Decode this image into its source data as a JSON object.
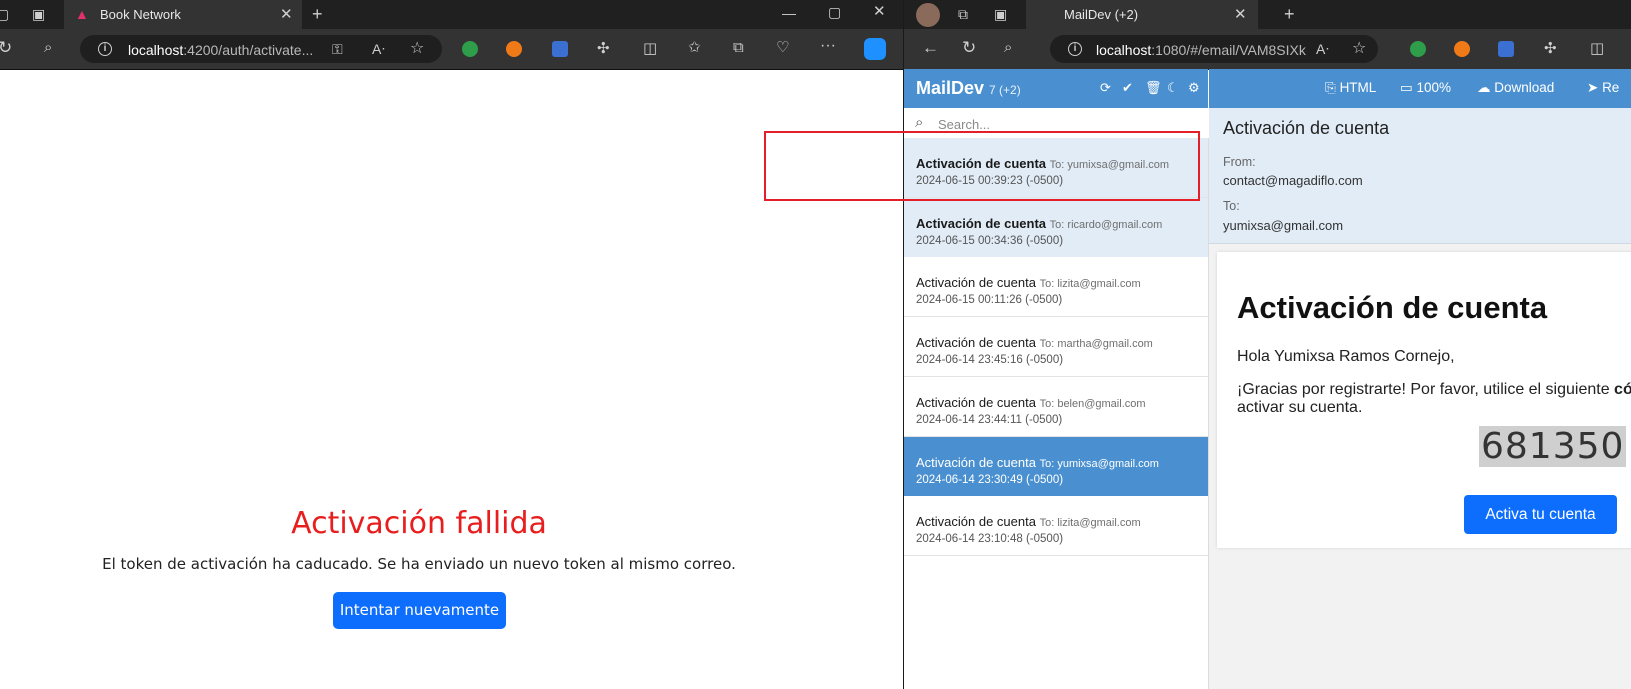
{
  "left_browser": {
    "tab_title": "Book Network",
    "url_host": "localhost",
    "url_rest": ":4200/auth/activate..."
  },
  "activation_page": {
    "title": "Activación fallida",
    "message": "El token de activación ha caducado. Se ha enviado un nuevo token al mismo correo.",
    "retry_button": "Intentar nuevamente"
  },
  "right_browser": {
    "tab_title": "MailDev (+2)",
    "url_host": "localhost",
    "url_rest": ":1080/#/email/VAM8SIXk"
  },
  "maildev": {
    "brand": "MailDev",
    "count": "7 (+2)",
    "search_placeholder": "Search...",
    "emails": [
      {
        "subject": "Activación de cuenta",
        "to": "To: yumixsa@gmail.com",
        "date": "2024-06-15 00:39:23 (-0500)",
        "state": "unread"
      },
      {
        "subject": "Activación de cuenta",
        "to": "To: ricardo@gmail.com",
        "date": "2024-06-15 00:34:36 (-0500)",
        "state": "unread"
      },
      {
        "subject": "Activación de cuenta",
        "to": "To: lizita@gmail.com",
        "date": "2024-06-15 00:11:26 (-0500)",
        "state": "read"
      },
      {
        "subject": "Activación de cuenta",
        "to": "To: martha@gmail.com",
        "date": "2024-06-14 23:45:16 (-0500)",
        "state": "read"
      },
      {
        "subject": "Activación de cuenta",
        "to": "To: belen@gmail.com",
        "date": "2024-06-14 23:44:11 (-0500)",
        "state": "read"
      },
      {
        "subject": "Activación de cuenta",
        "to": "To: yumixsa@gmail.com",
        "date": "2024-06-14 23:30:49 (-0500)",
        "state": "selected"
      },
      {
        "subject": "Activación de cuenta",
        "to": "To: lizita@gmail.com",
        "date": "2024-06-14 23:10:48 (-0500)",
        "state": "read"
      }
    ],
    "toolbar": {
      "html": "HTML",
      "zoom": "100%",
      "download": "Download",
      "reply": "Re"
    },
    "message": {
      "subject": "Activación de cuenta",
      "from_label": "From:",
      "from": "contact@magadiflo.com",
      "to_label": "To:",
      "to": "yumixsa@gmail.com"
    },
    "body": {
      "heading": "Activación de cuenta",
      "greeting": "Hola Yumixsa Ramos Cornejo,",
      "line1": "¡Gracias por registrarte! Por favor, utilice el siguiente ",
      "line1_bold": "cód",
      "line2": "activar su cuenta.",
      "code": "681350",
      "button": "Activa tu cuenta"
    }
  },
  "colors": {
    "accent": "#4a90d0",
    "error": "#e81e1e",
    "button": "#0d6efd",
    "highlight": "#e3202a"
  }
}
